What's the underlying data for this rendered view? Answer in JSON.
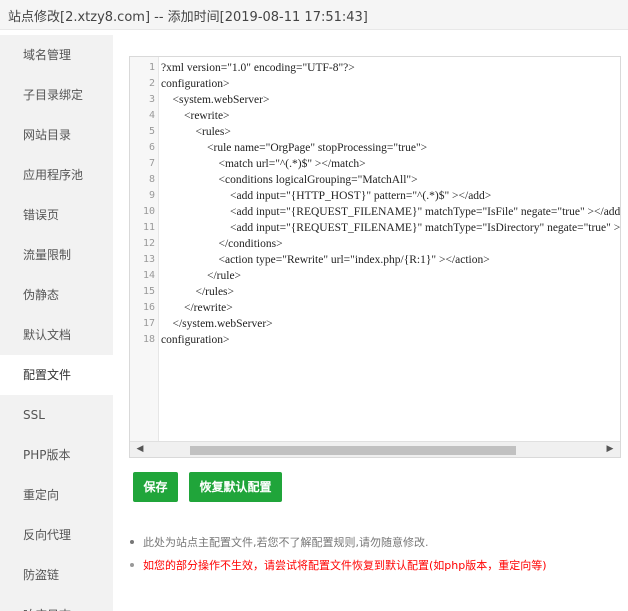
{
  "window": {
    "title": "站点修改[2.xtzy8.com] -- 添加时间[2019-08-11 17:51:43]"
  },
  "sidebar": {
    "active_index": 8,
    "items": [
      {
        "label": "域名管理"
      },
      {
        "label": "子目录绑定"
      },
      {
        "label": "网站目录"
      },
      {
        "label": "应用程序池"
      },
      {
        "label": "错误页"
      },
      {
        "label": "流量限制"
      },
      {
        "label": "伪静态"
      },
      {
        "label": "默认文档"
      },
      {
        "label": "配置文件"
      },
      {
        "label": "SSL"
      },
      {
        "label": "PHP版本"
      },
      {
        "label": "重定向"
      },
      {
        "label": "反向代理"
      },
      {
        "label": "防盗链"
      },
      {
        "label": "响应日志"
      }
    ]
  },
  "editor": {
    "lines": [
      {
        "num": "1",
        "text": "?xml version=\"1.0\" encoding=\"UTF-8\"?>"
      },
      {
        "num": "2",
        "text": "configuration>"
      },
      {
        "num": "3",
        "text": "    <system.webServer>"
      },
      {
        "num": "4",
        "text": "        <rewrite>"
      },
      {
        "num": "5",
        "text": "            <rules>"
      },
      {
        "num": "6",
        "text": "                <rule name=\"OrgPage\" stopProcessing=\"true\">"
      },
      {
        "num": "7",
        "text": "                    <match url=\"^(.*)$\" ></match>"
      },
      {
        "num": "8",
        "text": "                    <conditions logicalGrouping=\"MatchAll\">"
      },
      {
        "num": "9",
        "text": "                        <add input=\"{HTTP_HOST}\" pattern=\"^(.*)$\" ></add>"
      },
      {
        "num": "10",
        "text": "                        <add input=\"{REQUEST_FILENAME}\" matchType=\"IsFile\" negate=\"true\" ></add>"
      },
      {
        "num": "11",
        "text": "                        <add input=\"{REQUEST_FILENAME}\" matchType=\"IsDirectory\" negate=\"true\" ></add>"
      },
      {
        "num": "12",
        "text": "                    </conditions>"
      },
      {
        "num": "13",
        "text": "                    <action type=\"Rewrite\" url=\"index.php/{R:1}\" ></action>"
      },
      {
        "num": "14",
        "text": "                </rule>"
      },
      {
        "num": "15",
        "text": "            </rules>"
      },
      {
        "num": "16",
        "text": "        </rewrite>"
      },
      {
        "num": "17",
        "text": "    </system.webServer>"
      },
      {
        "num": "18",
        "text": "configuration>"
      }
    ],
    "scroll_left_icon": "arrow-left-icon",
    "scroll_right_icon": "arrow-right-icon"
  },
  "actions": {
    "save_label": "保存",
    "restore_label": "恢复默认配置"
  },
  "notes": {
    "note1": "此处为站点主配置文件,若您不了解配置规则,请勿随意修改.",
    "note2": "如您的部分操作不生效，请尝试将配置文件恢复到默认配置(如php版本，重定向等)"
  },
  "colors": {
    "accent_green": "#20a53a",
    "warning_red": "#ff0000",
    "sidebar_bg": "#f2f2f2"
  }
}
